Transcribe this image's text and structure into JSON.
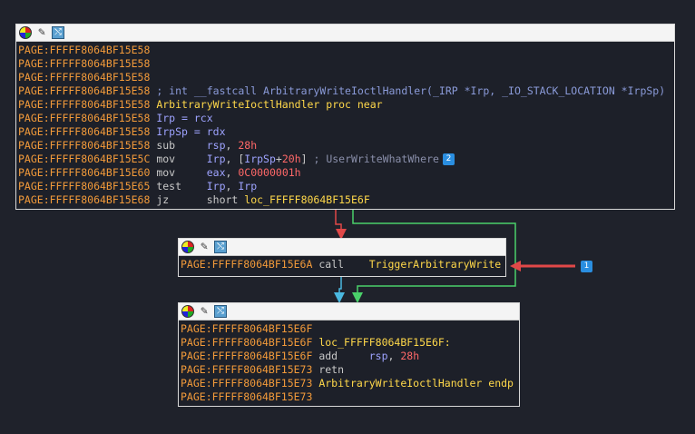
{
  "colors": {
    "addr": "#f29a3a",
    "name": "#ffd84a",
    "reg": "#9ea3ff",
    "num": "#ff6868",
    "comment": "#8a8faa",
    "edge_red": "#e04848",
    "edge_green": "#4ad06a",
    "edge_blue": "#4ab8e0"
  },
  "node1": {
    "icons": [
      "color-palette-icon",
      "edit-icon",
      "graph-icon"
    ],
    "lines": [
      {
        "addr": "PAGE:FFFFF8064BF15E58"
      },
      {
        "addr": "PAGE:FFFFF8064BF15E58"
      },
      {
        "addr": "PAGE:FFFFF8064BF15E58"
      },
      {
        "addr": "PAGE:FFFFF8064BF15E58",
        "proto": " ; int __fastcall ArbitraryWriteIoctlHandler(_IRP *Irp, _IO_STACK_LOCATION *IrpSp)"
      },
      {
        "addr": "PAGE:FFFFF8064BF15E58",
        "name": " ArbitraryWriteIoctlHandler proc near"
      },
      {
        "addr": "PAGE:FFFFF8064BF15E58",
        "reg": " Irp = rcx"
      },
      {
        "addr": "PAGE:FFFFF8064BF15E58",
        "reg": " IrpSp = rdx"
      },
      {
        "addr": "PAGE:FFFFF8064BF15E58",
        "mn": " sub     ",
        "op1": "rsp",
        "sep": ", ",
        "op2": "28h"
      },
      {
        "addr": "PAGE:FFFFF8064BF15E5C",
        "mn": " mov     ",
        "op1": "Irp",
        "sep": ", [",
        "op2a": "IrpSp",
        "plus": "+",
        "op2b": "20h",
        "close": "]",
        "cmt": " ; UserWriteWhatWhere",
        "badge": "2"
      },
      {
        "addr": "PAGE:FFFFF8064BF15E60",
        "mn": " mov     ",
        "op1": "eax",
        "sep": ", ",
        "op2": "0C0000001h"
      },
      {
        "addr": "PAGE:FFFFF8064BF15E65",
        "mn": " test    ",
        "op1": "Irp",
        "sep": ", ",
        "op2r": "Irp"
      },
      {
        "addr": "PAGE:FFFFF8064BF15E68",
        "mn": " jz      ",
        "short": "short ",
        "target": "loc_FFFFF8064BF15E6F"
      }
    ]
  },
  "node2": {
    "lines": [
      {
        "addr": "PAGE:FFFFF8064BF15E6A",
        "mn": " call    ",
        "target": "TriggerArbitraryWrite"
      }
    ],
    "badge": "1"
  },
  "node3": {
    "lines": [
      {
        "addr": "PAGE:FFFFF8064BF15E6F"
      },
      {
        "addr": "PAGE:FFFFF8064BF15E6F",
        "name": " loc_FFFFF8064BF15E6F:"
      },
      {
        "addr": "PAGE:FFFFF8064BF15E6F",
        "mn": " add     ",
        "op1": "rsp",
        "sep": ", ",
        "op2": "28h"
      },
      {
        "addr": "PAGE:FFFFF8064BF15E73",
        "mn": " retn"
      },
      {
        "addr": "PAGE:FFFFF8064BF15E73",
        "name": " ArbitraryWriteIoctlHandler endp"
      },
      {
        "addr": "PAGE:FFFFF8064BF15E73"
      }
    ]
  }
}
